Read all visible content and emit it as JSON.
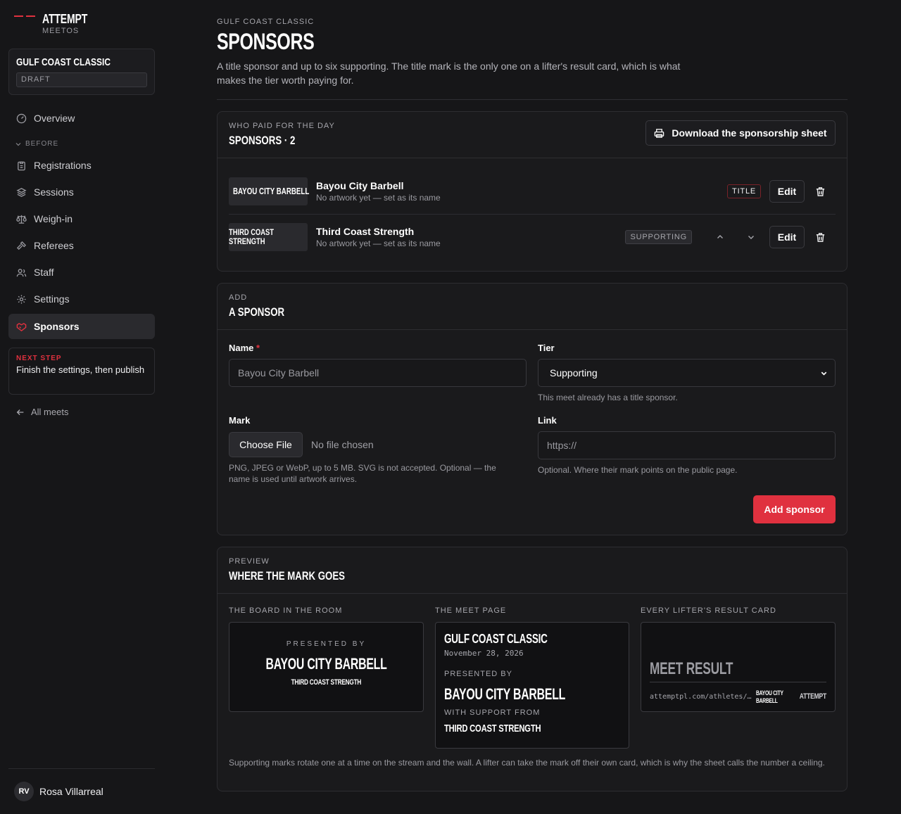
{
  "brand": {
    "name": "ATTEMPT",
    "sub": "MEETOS"
  },
  "meet": {
    "name": "GULF COAST CLASSIC",
    "status": "DRAFT"
  },
  "nav": {
    "overview": "Overview",
    "before_section": "BEFORE",
    "registrations": "Registrations",
    "sessions": "Sessions",
    "weighin": "Weigh-in",
    "referees": "Referees",
    "staff": "Staff",
    "settings": "Settings",
    "sponsors": "Sponsors"
  },
  "next_step": {
    "title": "NEXT STEP",
    "text": "Finish the settings, then publish"
  },
  "all_meets": "All meets",
  "user": {
    "initials": "RV",
    "name": "Rosa Villarreal"
  },
  "page": {
    "eyebrow": "GULF COAST CLASSIC",
    "title": "SPONSORS",
    "lead": "A title sponsor and up to six supporting. The title mark is the only one on a lifter's result card, which is what makes the tier worth paying for."
  },
  "list_panel": {
    "eyebrow": "WHO PAID FOR THE DAY",
    "title": "SPONSORS · 2",
    "download_label": "Download the sponsorship sheet"
  },
  "sponsors": [
    {
      "thumb": "BAYOU CITY BARBELL",
      "name": "Bayou City Barbell",
      "sub": "No artwork yet — set as its name",
      "tier": "TITLE",
      "edit": "Edit"
    },
    {
      "thumb1": "THIRD COAST",
      "thumb2": "STRENGTH",
      "name": "Third Coast Strength",
      "sub": "No artwork yet — set as its name",
      "tier": "SUPPORTING",
      "edit": "Edit"
    }
  ],
  "add_panel": {
    "eyebrow": "ADD",
    "title": "A SPONSOR"
  },
  "form": {
    "name_label": "Name",
    "name_required": "*",
    "name_placeholder": "Bayou City Barbell",
    "tier_label": "Tier",
    "tier_value": "Supporting",
    "tier_help": "This meet already has a title sponsor.",
    "mark_label": "Mark",
    "file_button": "Choose File",
    "file_status": "No file chosen",
    "mark_help": "PNG, JPEG or WebP, up to 5 MB. SVG is not accepted. Optional — the name is used until artwork arrives.",
    "link_label": "Link",
    "link_placeholder": "https://",
    "link_help": "Optional. Where their mark points on the public page.",
    "submit": "Add sponsor"
  },
  "preview": {
    "eyebrow": "PREVIEW",
    "title": "WHERE THE MARK GOES",
    "col1": "THE BOARD IN THE ROOM",
    "col2": "THE MEET PAGE",
    "col3": "EVERY LIFTER'S RESULT CARD",
    "board": {
      "presented": "PRESENTED BY",
      "title_sponsor": "BAYOU CITY BARBELL",
      "supporting": "THIRD COAST STRENGTH"
    },
    "page_card": {
      "meet": "GULF COAST CLASSIC",
      "date": "November 28, 2026",
      "presented": "PRESENTED BY",
      "title_sponsor": "BAYOU CITY BARBELL",
      "support_label": "WITH SUPPORT FROM",
      "supporting": "THIRD COAST STRENGTH"
    },
    "result": {
      "title": "MEET RESULT",
      "url": "attemptpl.com/athletes/…",
      "sponsor1": "BAYOU CITY",
      "sponsor2": "BARBELL",
      "brand": "ATTEMPT"
    },
    "note": "Supporting marks rotate one at a time on the stream and the wall. A lifter can take the mark off their own card, which is why the sheet calls the number a ceiling."
  }
}
